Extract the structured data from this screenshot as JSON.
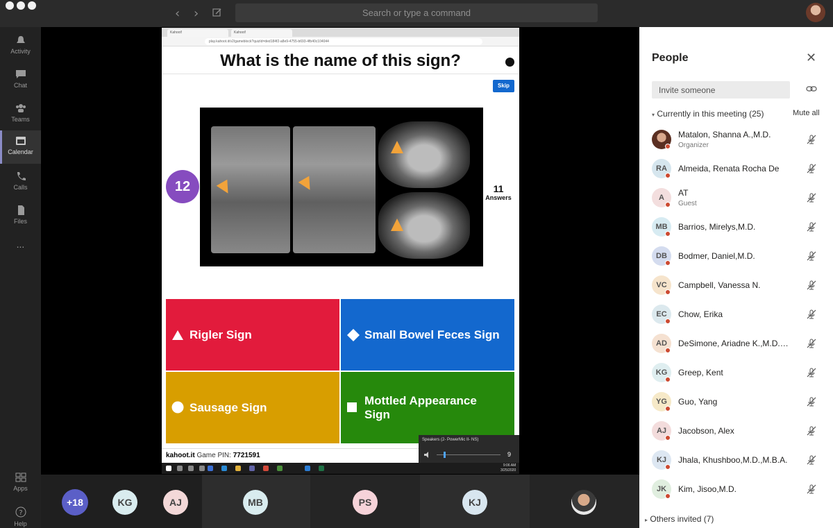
{
  "titlebar": {
    "search_placeholder": "Search or type a command"
  },
  "rail": {
    "items": [
      {
        "label": "Activity"
      },
      {
        "label": "Chat"
      },
      {
        "label": "Teams"
      },
      {
        "label": "Calendar"
      },
      {
        "label": "Calls"
      },
      {
        "label": "Files"
      },
      {
        "label": "..."
      }
    ],
    "bottom": [
      {
        "label": "Apps"
      },
      {
        "label": "Help"
      }
    ]
  },
  "share": {
    "tabs": [
      "Kahoot!",
      "Kahoot!"
    ],
    "url": "play.kahoot.it/v2/gameblock?quizId=ded184f2-a8e9-4755-b693-4fb40c104044",
    "question": "What is the name of this sign?",
    "skip": "Skip",
    "timer": "12",
    "answers_count": "11",
    "answers_label": "Answers",
    "options": [
      {
        "label": "Rigler Sign"
      },
      {
        "label": "Small Bowel Feces Sign"
      },
      {
        "label": "Sausage Sign"
      },
      {
        "label": "Mottled Appearance Sign"
      }
    ],
    "footer_site": "kahoot.it",
    "footer_pin_label": "Game PIN:",
    "footer_pin": "7721591",
    "speaker_title": "Speakers (2- PowerMic II- NS)",
    "speaker_volume": "9",
    "clock_time": "9:06 AM",
    "clock_date": "3/25/2020"
  },
  "people": {
    "title": "People",
    "invite_placeholder": "Invite someone",
    "meeting_header": "Currently in this meeting",
    "meeting_count": "(25)",
    "mute_all": "Mute all",
    "participants": [
      {
        "initials": "",
        "name": "Matalon, Shanna A.,M.D.",
        "role": "Organizer"
      },
      {
        "initials": "RA",
        "name": "Almeida, Renata Rocha De",
        "role": ""
      },
      {
        "initials": "A",
        "name": "AT",
        "role": "Guest"
      },
      {
        "initials": "MB",
        "name": "Barrios, Mirelys,M.D.",
        "role": ""
      },
      {
        "initials": "DB",
        "name": "Bodmer, Daniel,M.D.",
        "role": ""
      },
      {
        "initials": "VC",
        "name": "Campbell, Vanessa N.",
        "role": ""
      },
      {
        "initials": "EC",
        "name": "Chow, Erika",
        "role": ""
      },
      {
        "initials": "AD",
        "name": "DeSimone, Ariadne K.,M.D.,...",
        "role": ""
      },
      {
        "initials": "KG",
        "name": "Greep, Kent",
        "role": ""
      },
      {
        "initials": "YG",
        "name": "Guo, Yang",
        "role": ""
      },
      {
        "initials": "AJ",
        "name": "Jacobson, Alex",
        "role": ""
      },
      {
        "initials": "KJ",
        "name": "Jhala, Khushboo,M.D.,M.B.A.",
        "role": ""
      },
      {
        "initials": "JK",
        "name": "Kim, Jisoo,M.D.",
        "role": ""
      }
    ],
    "others_invited": "Others invited",
    "others_count": "(7)"
  },
  "callbar": {
    "overflow": "+18",
    "tiles": [
      "KG",
      "AJ",
      "MB",
      "PS",
      "KJ"
    ]
  },
  "colors": {
    "kahoot_red": "#e21b3c",
    "kahoot_blue": "#1368ce",
    "kahoot_yellow": "#d89e00",
    "kahoot_green": "#26890c",
    "timer_purple": "#864cbf",
    "presence_busy": "#cc4a31"
  }
}
